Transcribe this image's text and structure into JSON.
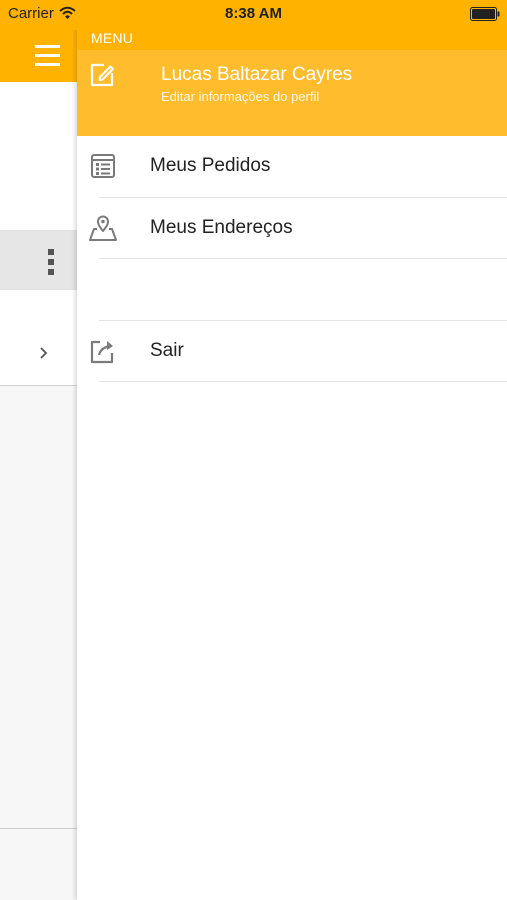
{
  "status_bar": {
    "carrier": "Carrier",
    "time": "8:38 AM"
  },
  "menu": {
    "title": "MENU",
    "profile": {
      "name": "Lucas Baltazar Cayres",
      "subtitle": "Editar informações do perfil",
      "icon": "edit-icon"
    },
    "items": [
      {
        "label": "Meus Pedidos",
        "icon": "list-icon"
      },
      {
        "label": "Meus Endereços",
        "icon": "map-pin-icon"
      },
      {
        "label": "Sair",
        "icon": "logout-icon"
      }
    ]
  },
  "colors": {
    "accent": "#ffb300",
    "profile_bg": "#ffbd2e",
    "icon_gray": "#7a7a7a"
  }
}
